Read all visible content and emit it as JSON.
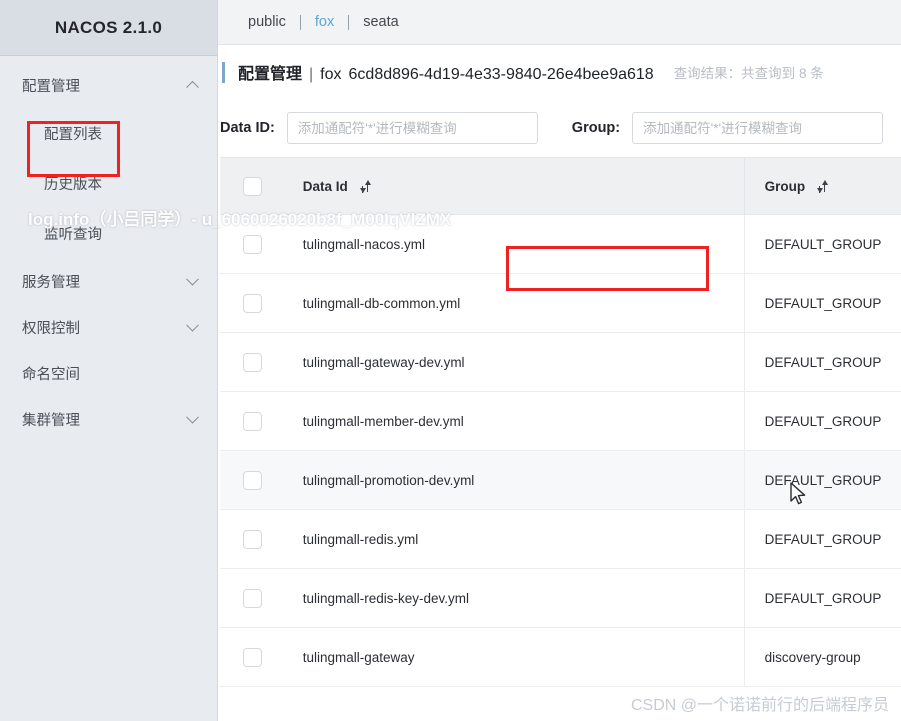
{
  "sidebar": {
    "brand": "NACOS 2.1.0",
    "items": [
      {
        "label": "配置管理",
        "type": "group",
        "chevron": "chevron-up-icon",
        "expanded": true
      },
      {
        "label": "配置列表",
        "type": "sub",
        "highlighted": true
      },
      {
        "label": "历史版本",
        "type": "sub"
      },
      {
        "label": "监听查询",
        "type": "sub"
      },
      {
        "label": "服务管理",
        "type": "group",
        "chevron": "chevron-down-icon",
        "expanded": false
      },
      {
        "label": "权限控制",
        "type": "group",
        "chevron": "chevron-down-icon",
        "expanded": false
      },
      {
        "label": "命名空间",
        "type": "group",
        "chevron": "none",
        "expanded": false
      },
      {
        "label": "集群管理",
        "type": "group",
        "chevron": "chevron-down-icon",
        "expanded": false
      }
    ]
  },
  "namespace_tabs": [
    {
      "label": "public",
      "active": false
    },
    {
      "label": "fox",
      "active": true
    },
    {
      "label": "seata",
      "active": false
    }
  ],
  "header": {
    "title": "配置管理",
    "separator": "|",
    "namespace_name": "fox",
    "namespace_id": "6cd8d896-4d19-4e33-9840-26e4bee9a618",
    "result_count_text": "查询结果：共查询到 8 条"
  },
  "search": {
    "dataid_label": "Data ID:",
    "dataid_value": "",
    "dataid_placeholder": "添加通配符'*'进行模糊查询",
    "group_label": "Group:",
    "group_value": "",
    "group_placeholder": "添加通配符'*'进行模糊查询"
  },
  "table": {
    "columns": [
      {
        "key": "check",
        "label": ""
      },
      {
        "key": "dataId",
        "label": "Data Id",
        "sortable": true,
        "sort_icon": "sort-icon"
      },
      {
        "key": "group",
        "label": "Group",
        "sortable": true,
        "sort_icon": "sort-icon"
      }
    ],
    "rows": [
      {
        "dataId": "tulingmall-nacos.yml",
        "group": "DEFAULT_GROUP",
        "checked": false,
        "highlighted": true,
        "hover": false
      },
      {
        "dataId": "tulingmall-db-common.yml",
        "group": "DEFAULT_GROUP",
        "checked": false,
        "highlighted": false,
        "hover": false
      },
      {
        "dataId": "tulingmall-gateway-dev.yml",
        "group": "DEFAULT_GROUP",
        "checked": false,
        "highlighted": false,
        "hover": false
      },
      {
        "dataId": "tulingmall-member-dev.yml",
        "group": "DEFAULT_GROUP",
        "checked": false,
        "highlighted": false,
        "hover": false
      },
      {
        "dataId": "tulingmall-promotion-dev.yml",
        "group": "DEFAULT_GROUP",
        "checked": false,
        "highlighted": false,
        "hover": true
      },
      {
        "dataId": "tulingmall-redis.yml",
        "group": "DEFAULT_GROUP",
        "checked": false,
        "highlighted": false,
        "hover": false
      },
      {
        "dataId": "tulingmall-redis-key-dev.yml",
        "group": "DEFAULT_GROUP",
        "checked": false,
        "highlighted": false,
        "hover": false
      },
      {
        "dataId": "tulingmall-gateway",
        "group": "discovery-group",
        "checked": false,
        "highlighted": false,
        "hover": false
      }
    ]
  },
  "watermarks": {
    "top": "log.info（小吕同学）- u_6060026020b8f_M00IqVlZMX",
    "bottom": "CSDN @一个诺诺前行的后端程序员"
  },
  "colors": {
    "accent_blue": "#5aa8d6",
    "annotation_red": "#ee2222",
    "sidebar_bg": "#e8ebf0",
    "brand_bg": "#d9dee5",
    "table_header_bg": "#eff0f2"
  }
}
